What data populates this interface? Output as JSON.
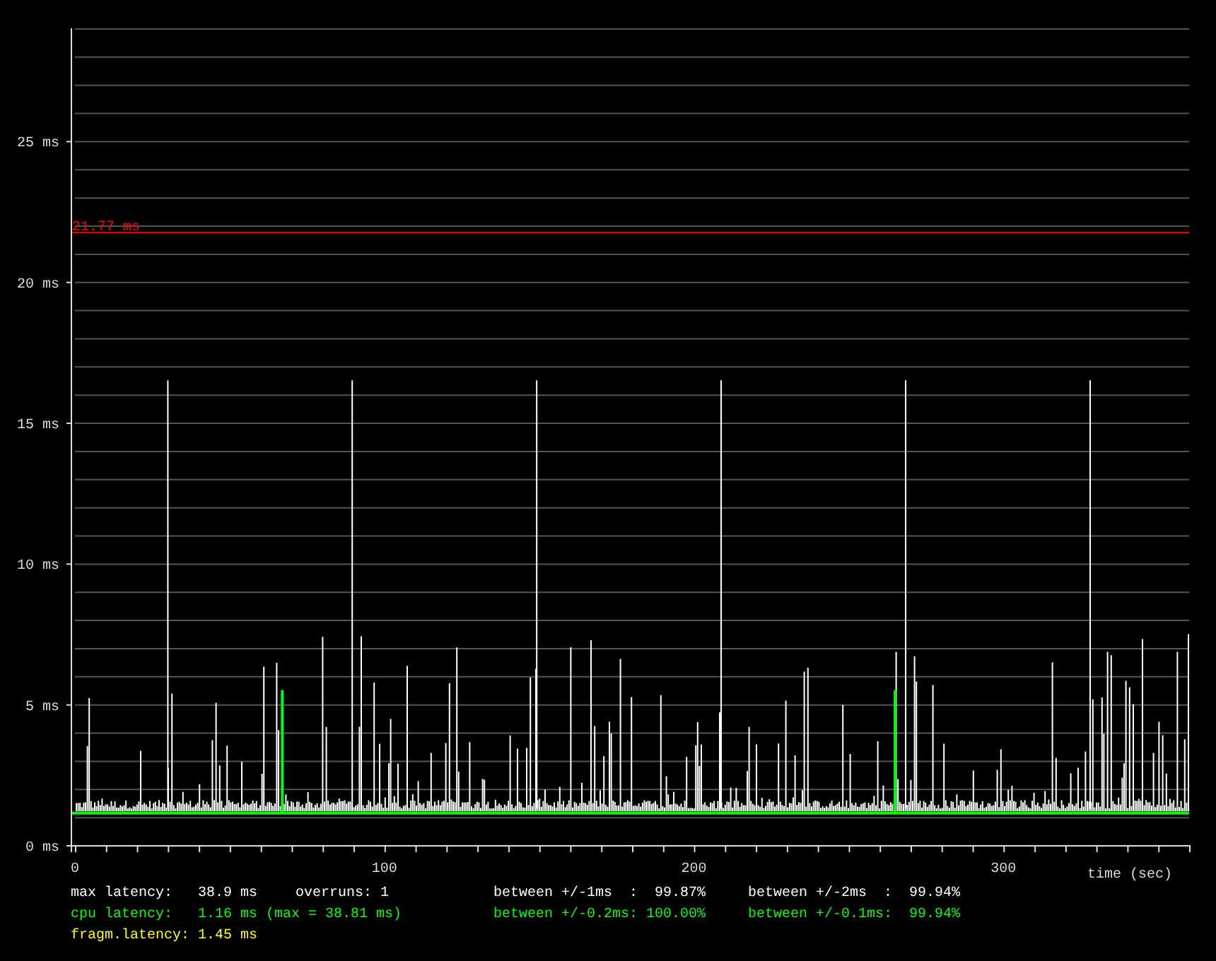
{
  "chart": {
    "chart_data": {
      "type": "line",
      "xlabel": "time (sec)",
      "xlim": [
        0,
        360
      ],
      "ylim": [
        0,
        29
      ],
      "xticks": [
        0,
        100,
        200,
        300
      ],
      "yticks": [
        {
          "value": 0,
          "label": "0 ms"
        },
        {
          "value": 5,
          "label": "5 ms"
        },
        {
          "value": 10,
          "label": "10 ms"
        },
        {
          "value": 15,
          "label": "15 ms"
        },
        {
          "value": 20,
          "label": "20 ms"
        },
        {
          "value": 25,
          "label": "25 ms"
        }
      ],
      "grid": true,
      "ref_lines": [
        {
          "axis": "y",
          "value": 21.77,
          "label": "21.77 ms",
          "color": "#ff0000"
        },
        {
          "axis": "y",
          "value": 1.16,
          "color": "#00ff00"
        }
      ]
    }
  },
  "stats": [
    {
      "color": "#ffffff",
      "items": [
        {
          "kind": "main",
          "text": "max latency:   38.9 ms"
        },
        {
          "kind": "extra",
          "text": "overruns: 1"
        },
        {
          "kind": "range",
          "text": "between +/-1ms  :  99.87%"
        },
        {
          "kind": "range",
          "text": "between +/-2ms  :  99.94%"
        }
      ]
    },
    {
      "color": "#00ff00",
      "items": [
        {
          "kind": "main",
          "text": "cpu latency:   1.16 ms (max = 38.81 ms)"
        },
        {
          "kind": "range",
          "text": "between +/-0.2ms: 100.00%"
        },
        {
          "kind": "range",
          "text": "between +/-0.1ms:  99.94%"
        }
      ]
    },
    {
      "color": "#ffff00",
      "items": [
        {
          "kind": "main",
          "text": "fragm.latency: 1.45 ms"
        }
      ]
    }
  ]
}
